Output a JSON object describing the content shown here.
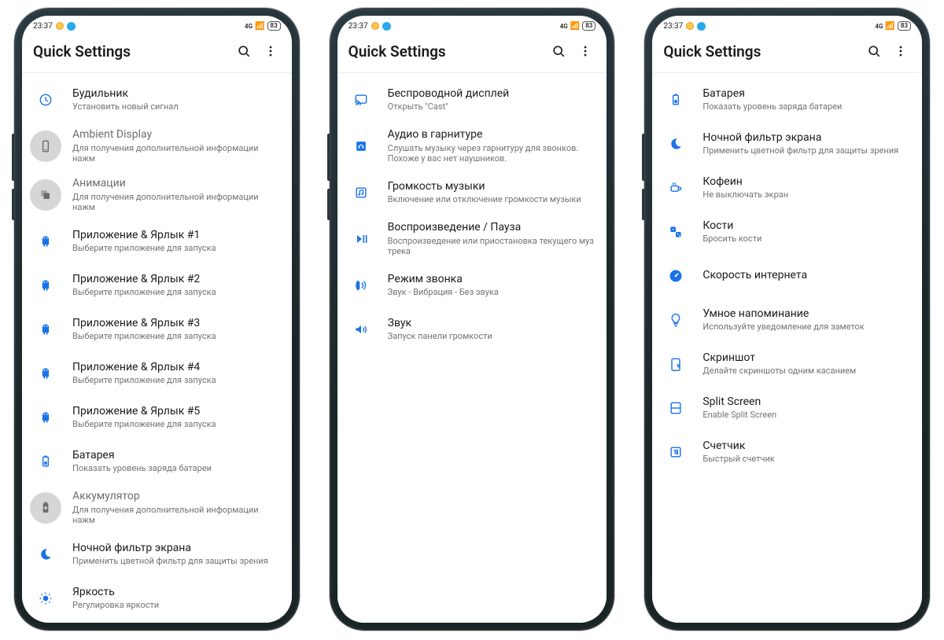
{
  "status": {
    "time": "23:37",
    "network": "4G",
    "batt": "83"
  },
  "apptitle": "Quick Settings",
  "screens": [
    [
      {
        "icon": "clock",
        "title": "Будильник",
        "sub": "Установить новый сигнал"
      },
      {
        "icon": "phone-rect",
        "title": "Ambient Display",
        "sub": "Для получения дополнительной информации нажм",
        "disabled": true
      },
      {
        "icon": "anim",
        "title": "Анимации",
        "sub": "Для получения дополнительной информации нажм",
        "disabled": true
      },
      {
        "icon": "android",
        "title": "Приложение & Ярлык #1",
        "sub": "Выберите приложение для запуска"
      },
      {
        "icon": "android",
        "title": "Приложение & Ярлык #2",
        "sub": "Выберите приложение для запуска"
      },
      {
        "icon": "android",
        "title": "Приложение & Ярлык #3",
        "sub": "Выберите приложение для запуска"
      },
      {
        "icon": "android",
        "title": "Приложение & Ярлык #4",
        "sub": "Выберите приложение для запуска"
      },
      {
        "icon": "android",
        "title": "Приложение & Ярлык #5",
        "sub": "Выберите приложение для запуска"
      },
      {
        "icon": "battery",
        "title": "Батарея",
        "sub": "Показать уровень заряда батареи"
      },
      {
        "icon": "batt-plus",
        "title": "Аккумулятор",
        "sub": "Для получения дополнительной информации нажм",
        "disabled": true
      },
      {
        "icon": "moon",
        "title": "Ночной фильтр экрана",
        "sub": "Применить цветной фильтр для защиты зрения"
      },
      {
        "icon": "bright",
        "title": "Яркость",
        "sub": "Регулировка яркости"
      }
    ],
    [
      {
        "icon": "cast",
        "title": "Беспроводной дисплей",
        "sub": "Открыть \"Cast\""
      },
      {
        "icon": "headset",
        "title": "Аудио в гарнитуре",
        "sub": "Слушать музыку через гарнитуру для звонков. Похоже у вас нет наушников."
      },
      {
        "icon": "music-vol",
        "title": "Громкость музыки",
        "sub": "Включение или отключение громкости музыки"
      },
      {
        "icon": "playpause",
        "title": "Воспроизведение / Пауза",
        "sub": "Воспроизведение или приостановка текущего муз трека"
      },
      {
        "icon": "ringer",
        "title": "Режим звонка",
        "sub": "Звук - Вибрация - Без звука"
      },
      {
        "icon": "sound",
        "title": "Звук",
        "sub": "Запуск панели громкости"
      }
    ],
    [
      {
        "icon": "battery",
        "title": "Батарея",
        "sub": "Показать уровень заряда батареи"
      },
      {
        "icon": "moon",
        "title": "Ночной фильтр экрана",
        "sub": "Применить цветной фильтр для защиты зрения"
      },
      {
        "icon": "coffee",
        "title": "Кофеин",
        "sub": "Не выключать экран"
      },
      {
        "icon": "dice",
        "title": "Кости",
        "sub": "Бросить кости"
      },
      {
        "icon": "speed",
        "title": "Скорость интернета",
        "sub": ""
      },
      {
        "icon": "bulb",
        "title": "Умное напоминание",
        "sub": "Используйте уведомление для заметок"
      },
      {
        "icon": "shot",
        "title": "Скриншот",
        "sub": "Делайте скриншоты одним касанием"
      },
      {
        "icon": "split",
        "title": "Split Screen",
        "sub": "Enable Split Screen"
      },
      {
        "icon": "counter",
        "title": "Счетчик",
        "sub": "Быстрый счетчик"
      }
    ]
  ]
}
